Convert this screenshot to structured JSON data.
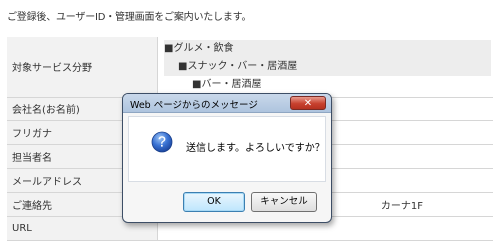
{
  "intro_text": "ご登録後、ユーザーID・管理画面をご案内いたします。",
  "form": {
    "rows": [
      {
        "label": "対象サービス分野",
        "categories": [
          "■グルメ・飲食",
          "■スナック・バー・居酒屋",
          "■バー・居酒屋"
        ]
      },
      {
        "label": "会社名(お名前)",
        "value": ""
      },
      {
        "label": "フリガナ",
        "value": ""
      },
      {
        "label": "担当者名",
        "value": ""
      },
      {
        "label": "メールアドレス",
        "value": ""
      },
      {
        "label": "ご連絡先",
        "value": "カーナ1F"
      },
      {
        "label": "URL",
        "value": ""
      }
    ]
  },
  "dialog": {
    "title": "Web ページからのメッセージ",
    "close_label": "✕",
    "message": "送信します。よろしいですか？",
    "icon": "question-icon",
    "ok_label": "OK",
    "cancel_label": "キャンセル"
  },
  "colors": {
    "label_bg": "#f2f2f2",
    "border": "#d6d6d6",
    "titlebar": "#b9cde4",
    "close_button": "#c8412f",
    "icon_blue": "#2a62c4"
  }
}
